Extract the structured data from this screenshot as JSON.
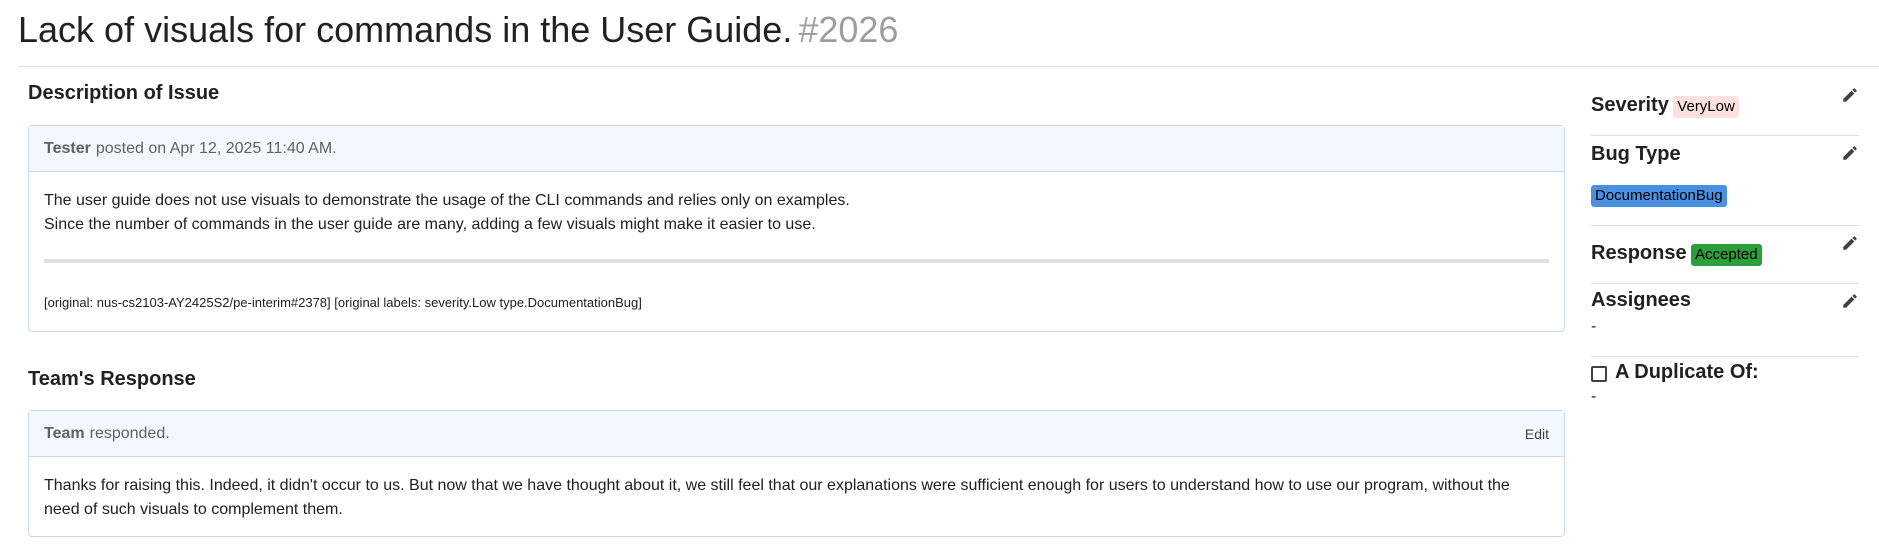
{
  "issue": {
    "title": "Lack of visuals for commands in the User Guide.",
    "number": "#2026"
  },
  "description": {
    "heading": "Description of Issue",
    "author": "Tester",
    "meta": "posted on Apr 12, 2025 11:40 AM.",
    "lines": [
      "The user guide does not use visuals to demonstrate the usage of the CLI commands and relies only on examples.",
      "Since the number of commands in the user guide are many, adding a few visuals might make it easier to use."
    ],
    "original": "[original: nus-cs2103-AY2425S2/pe-interim#2378] [original labels: severity.Low type.DocumentationBug]"
  },
  "response": {
    "heading": "Team's Response",
    "author": "Team",
    "meta": "responded.",
    "edit_label": "Edit",
    "text": "Thanks for raising this. Indeed, it didn't occur to us. But now that we have thought about it, we still feel that our explanations were sufficient enough for users to understand how to use our program, without the need of such visuals to complement them."
  },
  "sidebar": {
    "severity": {
      "label": "Severity",
      "value": "VeryLow",
      "color": "#fde0e0"
    },
    "bug_type": {
      "label": "Bug Type",
      "value": "DocumentationBug",
      "color": "#4a90e2"
    },
    "response": {
      "label": "Response",
      "value": "Accepted",
      "color": "#2e9e3a"
    },
    "assignees": {
      "label": "Assignees",
      "value": "-"
    },
    "duplicate": {
      "label": "A Duplicate Of:",
      "value": "-",
      "checked": false
    },
    "edit_icon": "pencil-icon"
  }
}
